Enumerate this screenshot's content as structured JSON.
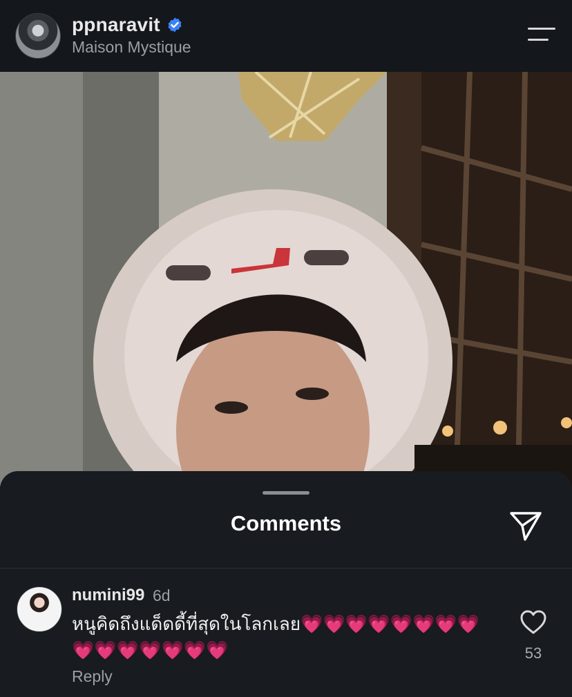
{
  "header": {
    "username": "ppnaravit",
    "location": "Maison Mystique",
    "verified_icon": "verified-badge-icon",
    "menu_icon": "menu-icon"
  },
  "comments_sheet": {
    "title": "Comments",
    "send_icon": "send-icon",
    "comment": {
      "username": "numini99",
      "time": "6d",
      "text": "หนูคิดถึงแด็ดดี้ที่สุดในโลกเลย💗💗💗💗💗💗💗💗💗💗💗💗💗💗💗",
      "reply_label": "Reply",
      "like_icon": "heart-icon",
      "like_count": "53"
    }
  },
  "colors": {
    "background": "#0f1115",
    "sheet": "#181b20",
    "verified_blue": "#3b82f6",
    "muted_text": "#9aa0a6"
  }
}
